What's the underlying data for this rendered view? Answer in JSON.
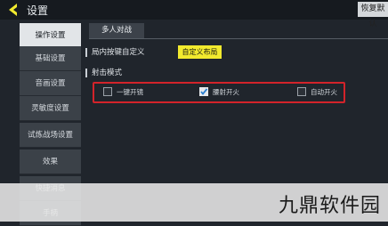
{
  "header": {
    "title": "设置",
    "restore_label": "恢复默认"
  },
  "sidebar": {
    "items": [
      {
        "label": "操作设置",
        "active": true
      },
      {
        "label": "基础设置"
      },
      {
        "label": "音画设置"
      },
      {
        "label": "灵敏度设置"
      },
      {
        "label": "试炼战场设置"
      },
      {
        "label": "效果"
      },
      {
        "label": "快捷消息"
      },
      {
        "label": "手柄"
      }
    ]
  },
  "tabs": [
    {
      "label": "多人对战"
    }
  ],
  "sections": {
    "custom_layout": {
      "title": "局内按键自定义",
      "button_label": "自定义布局"
    },
    "fire_mode": {
      "title": "射击模式",
      "options": [
        {
          "label": "一键开镜",
          "checked": false
        },
        {
          "label": "腰射开火",
          "checked": true
        },
        {
          "label": "自动开火",
          "checked": false
        }
      ]
    }
  },
  "watermark": {
    "text": "九鼎软件园"
  },
  "colors": {
    "highlight_border": "#d3232a",
    "accent_button": "#f2ea2e",
    "back_arrow": "#f2ea2e"
  }
}
